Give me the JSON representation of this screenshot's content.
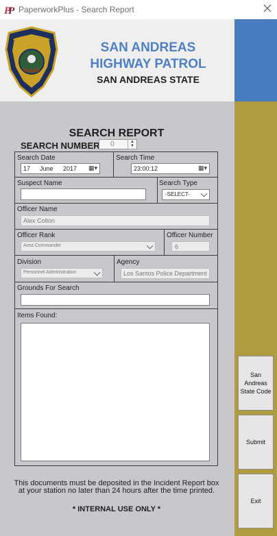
{
  "window": {
    "title": "PaperworkPlus - Search Report"
  },
  "header": {
    "agency": "SAN ANDREAS HIGHWAY PATROL",
    "state": "SAN ANDREAS STATE"
  },
  "form": {
    "title": "SEARCH REPORT",
    "search_number_label": "SEARCH NUMBER:",
    "search_number": "0",
    "search_date_label": "Search Date",
    "date_day": "17",
    "date_month": "June",
    "date_year": "2017",
    "search_time_label": "Search Time",
    "time_value": "23:00:12",
    "suspect_name_label": "Suspect Name",
    "suspect_name_value": "",
    "search_type_label": "Search Type",
    "search_type_value": "-SELECT-",
    "officer_name_label": "Officer Name",
    "officer_name_value": "Alex Colton",
    "officer_rank_label": "Officer Rank",
    "officer_rank_value": "Area Commander",
    "officer_number_label": "Officer Number",
    "officer_number_value": "6",
    "division_label": "Division",
    "division_value": "Personnel Administration",
    "agency_label": "Agency",
    "agency_value": "Los Santos Police Department",
    "grounds_label": "Grounds For Search",
    "grounds_value": "",
    "items_label": "Items Found:",
    "items_value": "",
    "notice": "This documents must be deposited in the Incident Report box at your station no later than 24 hours after the time printed.",
    "internal": "*  INTERNAL USE ONLY  *"
  },
  "sidebar": {
    "code_button": "San Andreas State Code",
    "submit_button": "Submit",
    "exit_button": "Exit"
  },
  "colors": {
    "header_blue": "#4f80c2",
    "side_blue": "#4a7cc0",
    "side_gold": "#b09b40",
    "form_bg": "#c8c8cc"
  }
}
